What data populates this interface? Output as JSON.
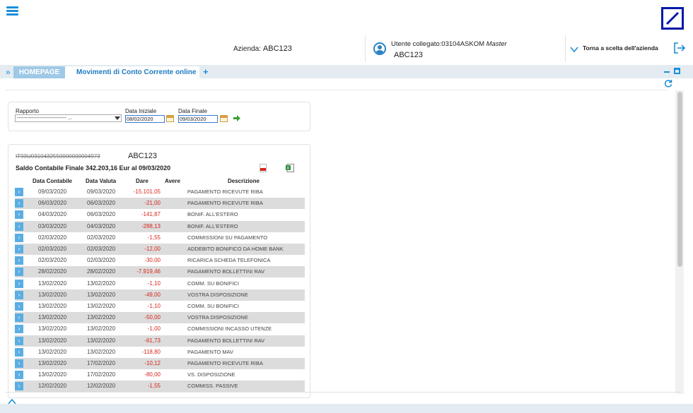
{
  "header": {
    "azienda_label": "Azienda:",
    "azienda_value": "ABC123",
    "user_label": "Utente collegato:03104ASKOM",
    "user_role": "Master",
    "user_name": "ABC123",
    "torna_label": "Torna a scelta dell'azienda"
  },
  "tabs": {
    "home": "HOMEPAGE",
    "movimenti": "Movimenti di Conto Corrente online",
    "add": "+"
  },
  "filters": {
    "rapporto_label": "Rapporto",
    "rapporto_value": "------------------------------  ...",
    "data_iniziale_label": "Data Iniziale",
    "data_iniziale_value": "08/02/2020",
    "data_finale_label": "Data Finale",
    "data_finale_value": "09/03/2020"
  },
  "account": {
    "iban_masked": "IT93U0310432550000000004973",
    "name": "ABC123",
    "saldo": "Saldo Contabile Finale 342.203,16  Eur al 09/03/2020"
  },
  "table": {
    "headers": [
      "Data Contabile",
      "Data Valuta",
      "Dare",
      "Avere",
      "Descrizione"
    ],
    "rows": [
      [
        "09/03/2020",
        "09/03/2020",
        "-15.101,05",
        "PAGAMENTO RICEVUTE RIBA"
      ],
      [
        "06/03/2020",
        "06/03/2020",
        "-21,00",
        "PAGAMENTO RICEVUTE RIBA"
      ],
      [
        "04/03/2020",
        "06/03/2020",
        "-141,87",
        "BONIF. ALL'ESTERO"
      ],
      [
        "03/03/2020",
        "04/03/2020",
        "-288,13",
        "BONIF. ALL'ESTERO"
      ],
      [
        "02/03/2020",
        "02/03/2020",
        "-1,55",
        "COMMISSIONI SU PAGAMENTO"
      ],
      [
        "02/03/2020",
        "02/03/2020",
        "-12,00",
        "ADDEBITO BONIFICO DA HOME BANK"
      ],
      [
        "02/03/2020",
        "02/03/2020",
        "-30,00",
        "RICARICA SCHEDA TELEFONICA"
      ],
      [
        "28/02/2020",
        "28/02/2020",
        "-7.919,46",
        "PAGAMENTO BOLLETTINI RAV"
      ],
      [
        "13/02/2020",
        "13/02/2020",
        "-1,10",
        "COMM. SU BONIFICI"
      ],
      [
        "13/02/2020",
        "13/02/2020",
        "-49,00",
        "VOSTRA DISPOSIZIONE"
      ],
      [
        "13/02/2020",
        "13/02/2020",
        "-1,10",
        "COMM. SU BONIFICI"
      ],
      [
        "13/02/2020",
        "13/02/2020",
        "-50,00",
        "VOSTRA DISPOSIZIONE"
      ],
      [
        "13/02/2020",
        "13/02/2020",
        "-1,00",
        "COMMISSIONI INCASSO UTENZE"
      ],
      [
        "13/02/2020",
        "13/02/2020",
        "-61,73",
        "PAGAMENTO BOLLETTINI RAV"
      ],
      [
        "13/02/2020",
        "13/02/2020",
        "-118,80",
        "PAGAMENTO MAV"
      ],
      [
        "13/02/2020",
        "17/02/2020",
        "-10,12",
        "PAGAMENTO RICEVUTE RIBA"
      ],
      [
        "13/02/2020",
        "17/02/2020",
        "-80,00",
        "VS. DISPOSIZIONE"
      ],
      [
        "12/02/2020",
        "12/02/2020",
        "-1,55",
        "COMMISS. PASSIVE"
      ]
    ]
  },
  "colors": {
    "accent": "#1a8fd8",
    "negative": "#d9251c",
    "row_alt": "#dcdcdc"
  }
}
